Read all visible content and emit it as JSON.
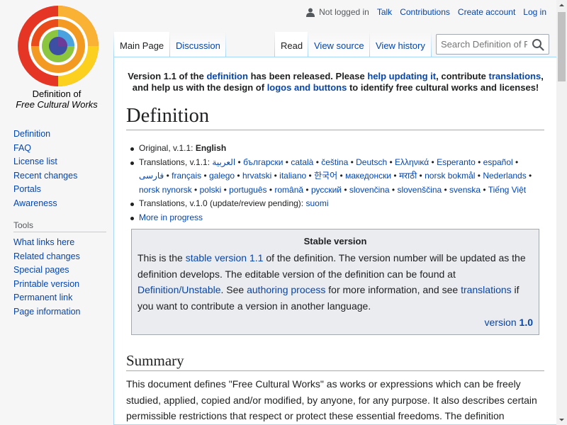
{
  "logo": {
    "line1": "Definition of",
    "line2": "Free Cultural Works"
  },
  "sidebar": {
    "nav": [
      "Definition",
      "FAQ",
      "License list",
      "Recent changes",
      "Portals",
      "Awareness"
    ],
    "tools_heading": "Tools",
    "tools": [
      "What links here",
      "Related changes",
      "Special pages",
      "Printable version",
      "Permanent link",
      "Page information"
    ]
  },
  "personal": {
    "not_logged_in": "Not logged in",
    "talk": "Talk",
    "contributions": "Contributions",
    "create_account": "Create account",
    "log_in": "Log in"
  },
  "tabs": {
    "main_page": "Main Page",
    "discussion": "Discussion",
    "read": "Read",
    "view_source": "View source",
    "view_history": "View history"
  },
  "search": {
    "placeholder": "Search Definition of Free Cultural Works"
  },
  "notice": {
    "t1": "Version 1.1 of the ",
    "l1": "definition",
    "t2": " has been released. Please ",
    "l2": "help updating it",
    "t3": ", contribute ",
    "l3": "translations",
    "t4": ",",
    "t5": "and help us with the design of ",
    "l4": "logos and buttons",
    "t6": " to identify free cultural works and licenses!"
  },
  "page_title": "Definition",
  "meta": {
    "original_prefix": "Original, v.1.1: ",
    "original_lang": "English",
    "translations_prefix": "Translations, v.1.1: ",
    "translations_v11": [
      "العربية",
      "български",
      "català",
      "čeština",
      "Deutsch",
      "Ελληνικά",
      "Esperanto",
      "español",
      "فارسی",
      "français",
      "galego",
      "hrvatski",
      "italiano",
      "한국어",
      "македонски",
      "मराठी",
      "norsk bokmål",
      "Nederlands",
      "norsk nynorsk",
      "polski",
      "português",
      "română",
      "русский",
      "slovenčina",
      "slovenščina",
      "svenska",
      "Tiếng Việt"
    ],
    "translations_v10_prefix": "Translations, v.1.0 (update/review pending): ",
    "translations_v10": [
      "suomi"
    ],
    "more": "More in progress"
  },
  "stable": {
    "title": "Stable version",
    "t1": "This is the ",
    "l1": "stable version 1.1",
    "t2": " of the definition. The version number will be updated as the definition develops. The editable version of the definition can be found at ",
    "l2": "Definition/Unstable",
    "t3": ". See ",
    "l3": "authoring process",
    "t4": " for more information, and see ",
    "l4": "translations",
    "t5": " if you want to contribute a version in another language.",
    "version_word": "version ",
    "version_num": "1.0"
  },
  "summary": {
    "heading": "Summary",
    "text": "This document defines \"Free Cultural Works\" as works or expressions which can be freely studied, applied, copied and/or modified, by anyone, for any purpose. It also describes certain permissible restrictions that respect or protect these essential freedoms. The definition"
  },
  "colors": {
    "link": "#0645ad",
    "bg": "#f6f6f6",
    "border": "#a7d7f9"
  }
}
